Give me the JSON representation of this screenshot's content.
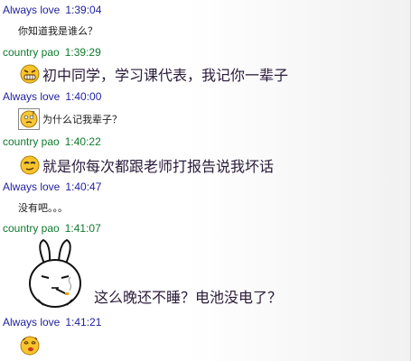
{
  "messages": [
    {
      "sender": "Always love",
      "time": "1:39:04",
      "text": "你知道我是谁么？"
    },
    {
      "sender": "country pao",
      "time": "1:39:29",
      "text": "初中同学，学习课代表，我记你一辈子",
      "emoticon": "grinning-teeth-emoticon"
    },
    {
      "sender": "Always love",
      "time": "1:40:00",
      "text": "为什么记我辈子？",
      "emoticon": "puzzled-emoticon"
    },
    {
      "sender": "country pao",
      "time": "1:40:22",
      "text": "就是你每次都跟老师打报告说我坏话",
      "emoticon": "cool-smirk-emoticon"
    },
    {
      "sender": "Always love",
      "time": "1:40:47",
      "text": "没有吧。。。"
    },
    {
      "sender": "country pao",
      "time": "1:41:07",
      "text": "这么晚还不睡？电池没电了？",
      "sticker": "rabbit-smoking-sticker"
    },
    {
      "sender": "Always love",
      "time": "1:41:21",
      "emoticon": "dizzy-confused-emoticon"
    }
  ],
  "colors": {
    "them_name": "#1f1f9e",
    "me_name": "#0f7a2e",
    "text": "#1a1a1a"
  }
}
